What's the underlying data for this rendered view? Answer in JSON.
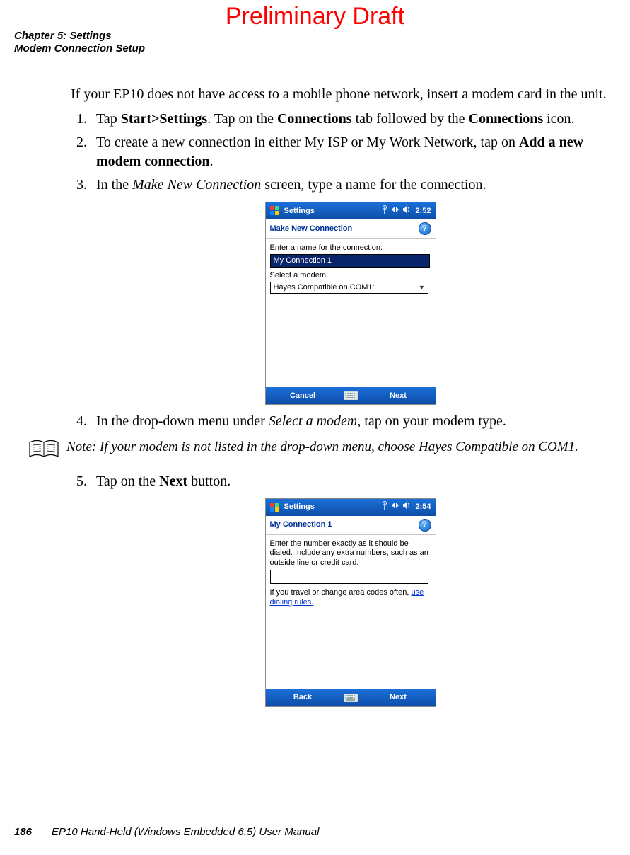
{
  "watermark": "Preliminary Draft",
  "header": {
    "chapter": "Chapter 5: Settings",
    "section": "Modem Connection Setup"
  },
  "body": {
    "intro": "If your EP10 does not have access to a mobile phone network, insert a modem card in the unit.",
    "step1": {
      "pre": "Tap ",
      "b1": "Start>Settings",
      "mid1": ". Tap on the ",
      "b2": "Connections",
      "mid2": " tab followed by the ",
      "b3": "Connections",
      "post": " icon."
    },
    "step2": {
      "pre": "To create a new connection in either My ISP or My Work Network, tap on ",
      "b1": "Add a new modem connection",
      "post": "."
    },
    "step3": {
      "pre": "In the ",
      "i1": "Make New Connection",
      "post": " screen, type a name for the connection."
    },
    "step4": {
      "pre": "In the drop-down menu under ",
      "i1": "Select a modem",
      "post": ", tap on your modem type."
    },
    "note": {
      "label": "Note:",
      "text": " If your modem is not listed in the drop-down menu, choose Hayes Compatible on COM1."
    },
    "step5": {
      "pre": "Tap on the ",
      "b1": "Next",
      "post": " button."
    }
  },
  "device1": {
    "titlebar_title": "Settings",
    "clock": "2:52",
    "subtitle": "Make New Connection",
    "help_glyph": "?",
    "label_name": "Enter a name for the connection:",
    "input_value": "My Connection 1",
    "label_modem": "Select a modem:",
    "combo_value": "Hayes Compatible on COM1:",
    "combo_arrow": "▼",
    "btn_left": "Cancel",
    "btn_right": "Next"
  },
  "device2": {
    "titlebar_title": "Settings",
    "clock": "2:54",
    "subtitle": "My Connection 1",
    "help_glyph": "?",
    "instr": "Enter the number exactly as it should be dialed.  Include any extra numbers, such as an outside line or credit card.",
    "hint_pre": "If you travel or change area codes often, ",
    "hint_link": "use dialing rules.",
    "btn_left": "Back",
    "btn_right": "Next"
  },
  "footer": {
    "page_number": "186",
    "manual_title": "EP10 Hand-Held (Windows Embedded 6.5) User Manual"
  }
}
